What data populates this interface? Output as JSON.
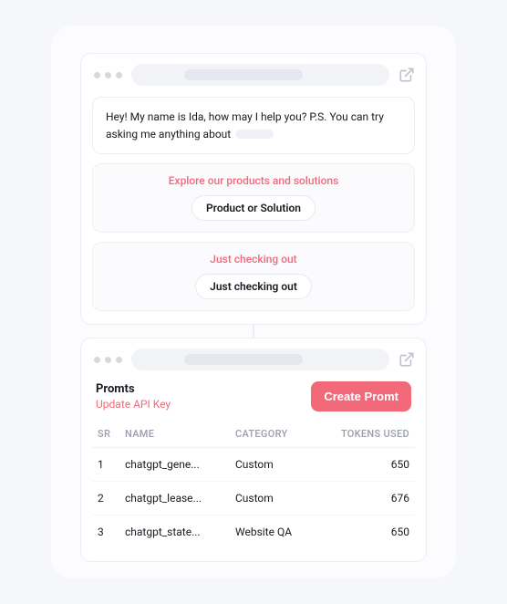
{
  "chat": {
    "message_prefix": "Hey! My name is Ida, how may I help you? P.S. You can try asking me anything about",
    "options": [
      {
        "title": "Explore our products and solutions",
        "button": "Product or Solution"
      },
      {
        "title": "Just checking out",
        "button": "Just checking out"
      }
    ]
  },
  "prompts": {
    "title": "Promts",
    "update_link": "Update API Key",
    "cta": "Create Promt",
    "columns": {
      "sr": "SR",
      "name": "NAME",
      "category": "CATEGORY",
      "tokens": "TOKENS USED"
    },
    "rows": [
      {
        "sr": "1",
        "name": "chatgpt_gene...",
        "category": "Custom",
        "tokens": "650"
      },
      {
        "sr": "2",
        "name": "chatgpt_lease...",
        "category": "Custom",
        "tokens": "676"
      },
      {
        "sr": "3",
        "name": "chatgpt_state...",
        "category": "Website QA",
        "tokens": "650"
      }
    ]
  }
}
